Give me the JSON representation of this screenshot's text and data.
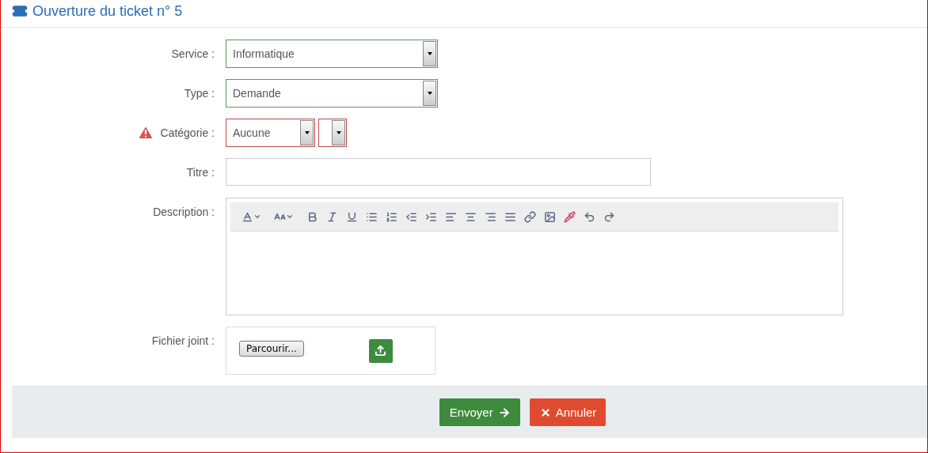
{
  "title": "Ouverture du ticket n° 5",
  "fields": [
    {
      "kind": "select",
      "label": "Service :",
      "value": "Informatique",
      "error": false
    },
    {
      "kind": "select",
      "label": "Type :",
      "value": "Demande",
      "error": false
    },
    {
      "kind": "double-select",
      "label": "Catégorie :",
      "value": "Aucune",
      "error": true
    },
    {
      "kind": "text",
      "label": "Titre :"
    },
    {
      "kind": "editor",
      "label": "Description :"
    },
    {
      "kind": "file",
      "label": "Fichier joint :",
      "button": "Parcourir..."
    }
  ],
  "actions": [
    {
      "kind": "submit",
      "label": "Envoyer"
    },
    {
      "kind": "cancel",
      "label": "Annuler"
    }
  ]
}
